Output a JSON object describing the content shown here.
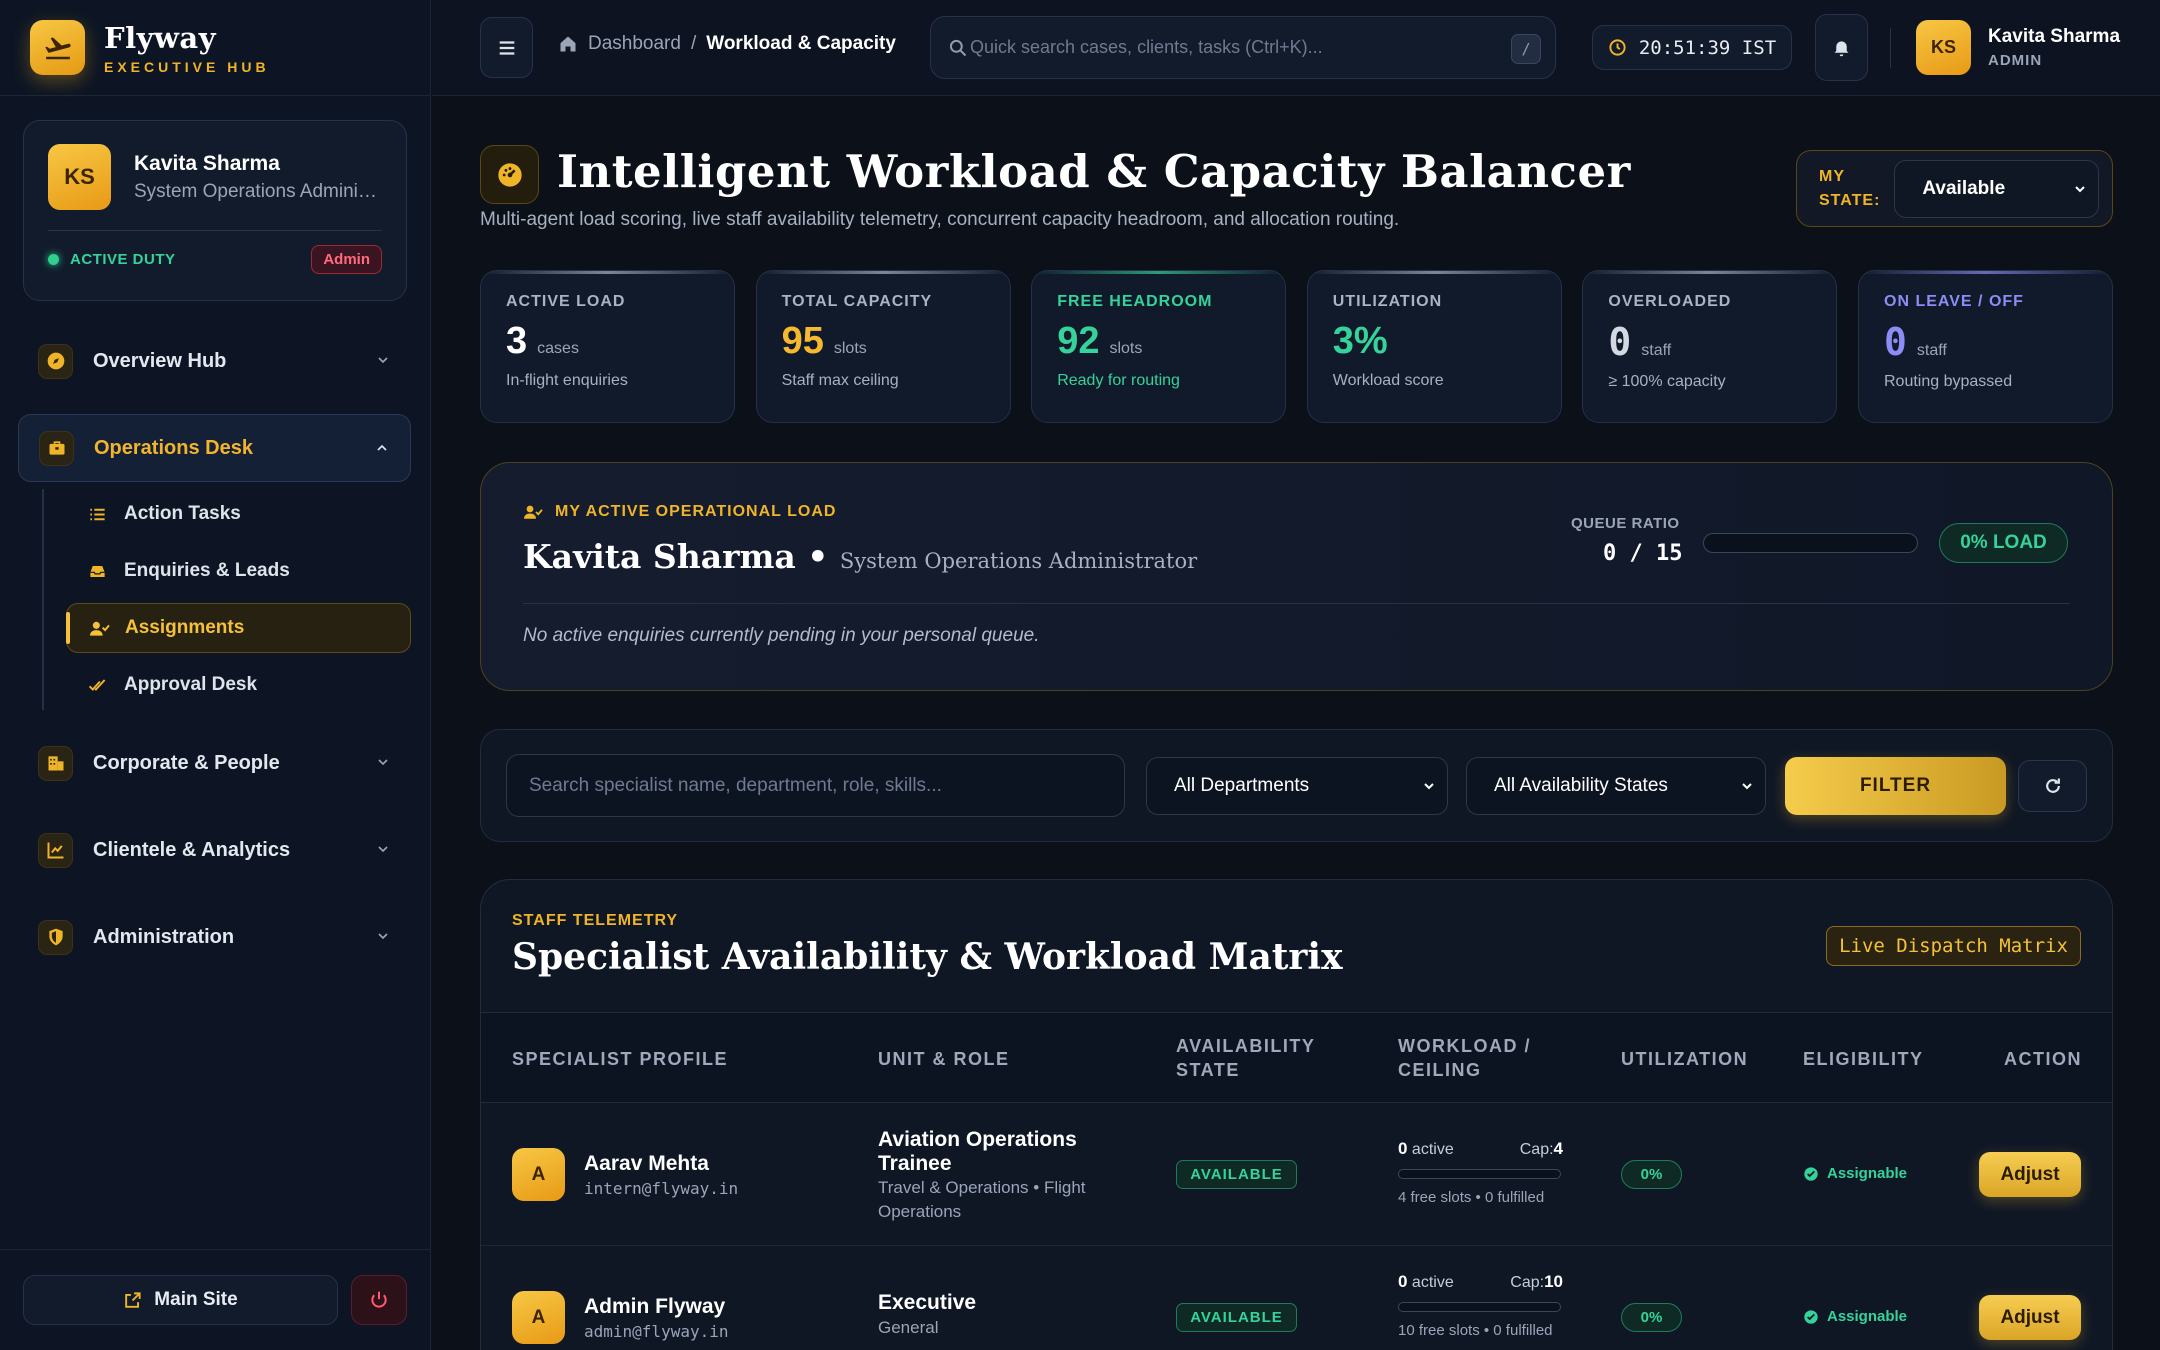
{
  "brand": {
    "name": "Flyway",
    "sub": "EXECUTIVE HUB"
  },
  "profile": {
    "initials": "KS",
    "name": "Kavita Sharma",
    "role": "System Operations Administrator",
    "duty": "ACTIVE DUTY",
    "badge": "Admin"
  },
  "nav": {
    "overview": "Overview Hub",
    "operations": "Operations Desk",
    "sub": {
      "action_tasks": "Action Tasks",
      "enquiries": "Enquiries & Leads",
      "assignments": "Assignments",
      "approval": "Approval Desk"
    },
    "corporate": "Corporate & People",
    "clientele": "Clientele & Analytics",
    "administration": "Administration"
  },
  "footer": {
    "main_site": "Main Site"
  },
  "topbar": {
    "breadcrumb": {
      "home": "Dashboard",
      "separator": "/",
      "current": "Workload & Capacity"
    },
    "search_placeholder": "Quick search cases, clients, tasks (Ctrl+K)...",
    "search_shortcut": "/",
    "clock": "20:51:39 IST",
    "user": {
      "initials": "KS",
      "name": "Kavita Sharma",
      "role": "ADMIN"
    }
  },
  "hero": {
    "title": "Intelligent Workload & Capacity Balancer",
    "subtitle": "Multi-agent load scoring, live staff availability telemetry, concurrent capacity headroom, and allocation routing.",
    "my_state_label_1": "MY",
    "my_state_label_2": "STATE:",
    "my_state_value": "Available"
  },
  "stats": [
    {
      "label": "ACTIVE LOAD",
      "value": "3",
      "unit": "cases",
      "sub": "In-flight enquiries",
      "color": "#a9b3c4",
      "num_color": "#ffffff"
    },
    {
      "label": "TOTAL CAPACITY",
      "value": "95",
      "unit": "slots",
      "sub": "Staff max ceiling",
      "color": "#a9b3c4",
      "num_color": "#f5b82e"
    },
    {
      "label": "FREE HEADROOM",
      "value": "92",
      "unit": "slots",
      "sub": "Ready for routing",
      "color": "#35d39a",
      "num_color": "#35d39a"
    },
    {
      "label": "UTILIZATION",
      "value": "3%",
      "unit": "",
      "sub": "Workload score",
      "color": "#a9b3c4",
      "num_color": "#35d39a"
    },
    {
      "label": "OVERLOADED",
      "value": "0",
      "unit": "staff",
      "sub": "≥ 100% capacity",
      "color": "#a9b3c4",
      "num_color": "#d3d9e3"
    },
    {
      "label": "ON LEAVE / OFF",
      "value": "0",
      "unit": "staff",
      "sub": "Routing bypassed",
      "color": "#8b8cf5",
      "num_color": "#8b8cf5"
    }
  ],
  "myload": {
    "kicker": "MY ACTIVE OPERATIONAL LOAD",
    "name": "Kavita Sharma •",
    "role": "System Operations Administrator",
    "queue_label": "QUEUE RATIO",
    "queue_value": "0 / 15",
    "load_fraction": 0,
    "load_pill": "0% LOAD",
    "empty": "No active enquiries currently pending in your personal queue."
  },
  "filters": {
    "search_placeholder": "Search specialist name, department, role, skills...",
    "departments": "All Departments",
    "states": "All Availability States",
    "button": "FILTER"
  },
  "matrix": {
    "kicker": "STAFF TELEMETRY",
    "title": "Specialist Availability & Workload Matrix",
    "badge": "Live Dispatch Matrix",
    "headers": {
      "profile": "SPECIALIST PROFILE",
      "unit": "UNIT & ROLE",
      "avail_1": "AVAILABILITY",
      "avail_2": "STATE",
      "wl_1": "WORKLOAD /",
      "wl_2": "CEILING",
      "util": "UTILIZATION",
      "elig": "ELIGIBILITY",
      "action": "ACTION"
    },
    "rows": [
      {
        "initial": "A",
        "name": "Aarav Mehta",
        "email": "intern@flyway.in",
        "role": "Aviation Operations Trainee",
        "dept": "Travel & Operations • Flight Operations",
        "state": "AVAILABLE",
        "active": "0",
        "active_label": "active",
        "cap_label": "Cap:",
        "cap": "4",
        "load_fraction": 0,
        "free": "4 free slots • 0 fulfilled",
        "util": "0%",
        "elig": "Assignable",
        "action": "Adjust"
      },
      {
        "initial": "A",
        "name": "Admin Flyway",
        "email": "admin@flyway.in",
        "role": "Executive",
        "dept": "General",
        "state": "AVAILABLE",
        "active": "0",
        "active_label": "active",
        "cap_label": "Cap:",
        "cap": "10",
        "load_fraction": 0,
        "free": "10 free slots • 0 fulfilled",
        "util": "0%",
        "elig": "Assignable",
        "action": "Adjust"
      }
    ]
  }
}
